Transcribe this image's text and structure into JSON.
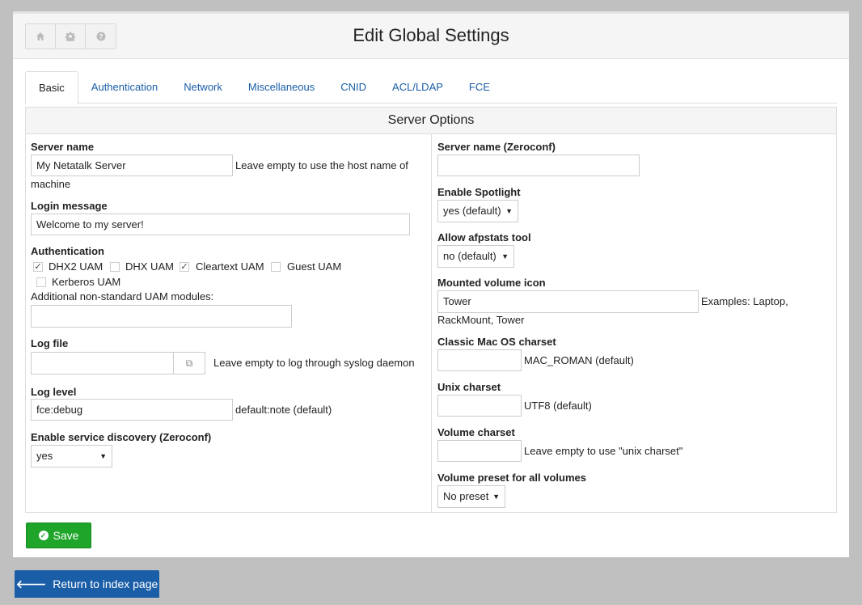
{
  "page": {
    "title": "Edit Global Settings"
  },
  "toolbar": {
    "home_icon": "home-icon",
    "settings_icon": "gear-icon",
    "help_icon": "help-icon"
  },
  "tabs": [
    {
      "label": "Basic",
      "active": true
    },
    {
      "label": "Authentication"
    },
    {
      "label": "Network"
    },
    {
      "label": "Miscellaneous"
    },
    {
      "label": "CNID"
    },
    {
      "label": "ACL/LDAP"
    },
    {
      "label": "FCE"
    }
  ],
  "section": {
    "title": "Server Options"
  },
  "left": {
    "server_name": {
      "label": "Server name",
      "value": "My Netatalk Server",
      "hint": "Leave empty to use the host name of",
      "hint2": "machine"
    },
    "login_message": {
      "label": "Login message",
      "value": "Welcome to my server!"
    },
    "authentication": {
      "label": "Authentication",
      "options": [
        {
          "label": "DHX2 UAM",
          "checked": true
        },
        {
          "label": "DHX UAM",
          "checked": false
        },
        {
          "label": "Cleartext UAM",
          "checked": true
        },
        {
          "label": "Guest UAM",
          "checked": false
        },
        {
          "label": "Kerberos UAM",
          "checked": false
        }
      ],
      "additional_label": "Additional non-standard UAM modules:",
      "additional_value": ""
    },
    "log_file": {
      "label": "Log file",
      "value": "",
      "hint": "Leave empty to log through syslog daemon"
    },
    "log_level": {
      "label": "Log level",
      "value": "fce:debug",
      "hint": "default:note (default)"
    },
    "zeroconf": {
      "label": "Enable service discovery (Zeroconf)",
      "value": "yes"
    }
  },
  "right": {
    "server_name_zeroconf": {
      "label": "Server name (Zeroconf)",
      "value": ""
    },
    "spotlight": {
      "label": "Enable Spotlight",
      "value": "yes (default)"
    },
    "afpstats": {
      "label": "Allow afpstats tool",
      "value": "no (default)"
    },
    "volume_icon": {
      "label": "Mounted volume icon",
      "value": "Tower",
      "hint": "Examples: Laptop,",
      "hint2": "RackMount, Tower"
    },
    "mac_charset": {
      "label": "Classic Mac OS charset",
      "value": "",
      "hint": "MAC_ROMAN (default)"
    },
    "unix_charset": {
      "label": "Unix charset",
      "value": "",
      "hint": "UTF8 (default)"
    },
    "volume_charset": {
      "label": "Volume charset",
      "value": "",
      "hint": "Leave empty to use \"unix charset\""
    },
    "volume_preset": {
      "label": "Volume preset for all volumes",
      "value": "No preset"
    }
  },
  "actions": {
    "save_label": "Save",
    "return_label": "Return to index page"
  },
  "colors": {
    "primary": "#1a5ea8",
    "success": "#1ea52a"
  }
}
